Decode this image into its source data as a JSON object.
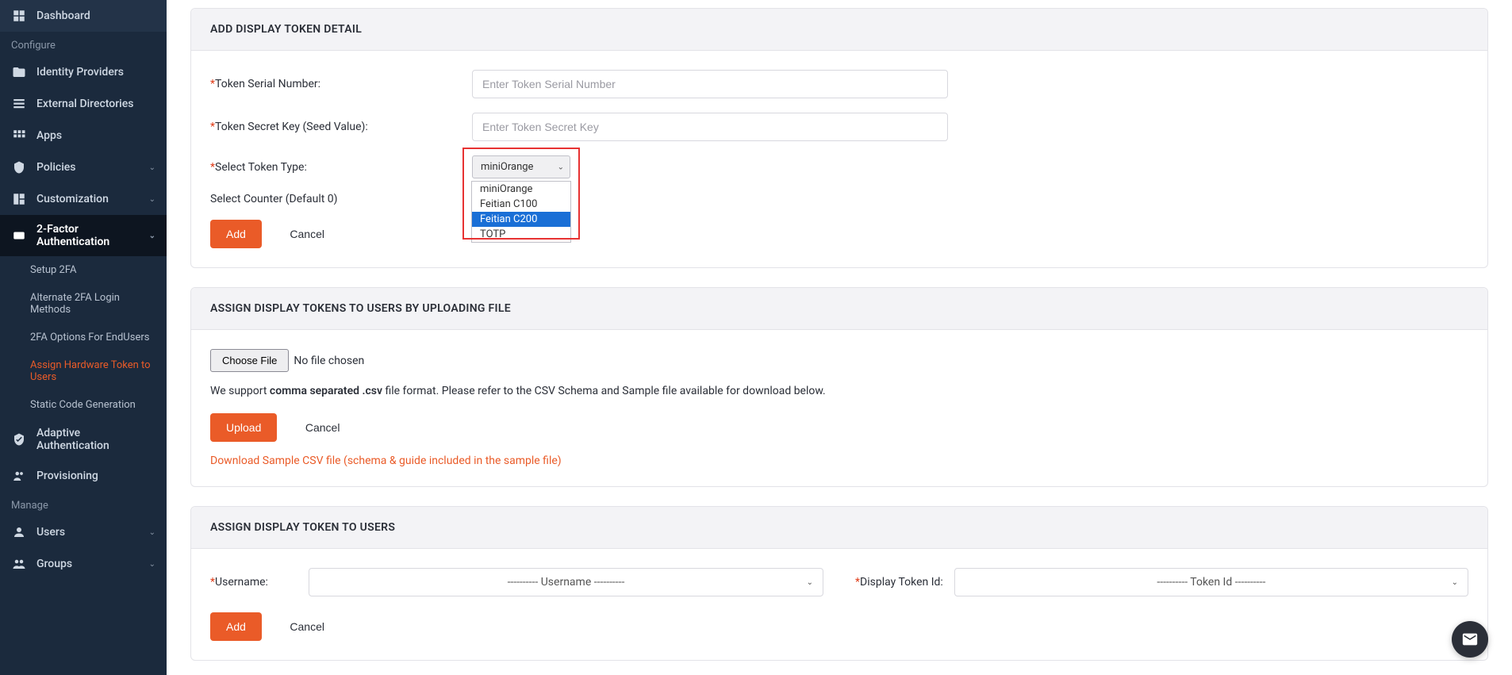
{
  "sidebar": {
    "items": [
      {
        "label": "Dashboard",
        "icon": "dashboard"
      }
    ],
    "section_configure": "Configure",
    "configure_items": [
      {
        "label": "Identity Providers",
        "icon": "idp"
      },
      {
        "label": "External Directories",
        "icon": "directories"
      },
      {
        "label": "Apps",
        "icon": "apps"
      },
      {
        "label": "Policies",
        "icon": "policies",
        "chev": true
      },
      {
        "label": "Customization",
        "icon": "custom",
        "chev": true
      },
      {
        "label": "2-Factor Authentication",
        "icon": "2fa",
        "chev": true,
        "active": true
      },
      {
        "label": "Adaptive Authentication",
        "icon": "adaptive"
      },
      {
        "label": "Provisioning",
        "icon": "provisioning"
      }
    ],
    "sub_2fa": [
      {
        "label": "Setup 2FA"
      },
      {
        "label": "Alternate 2FA Login Methods"
      },
      {
        "label": "2FA Options For EndUsers"
      },
      {
        "label": "Assign Hardware Token to Users",
        "highlight": true
      },
      {
        "label": "Static Code Generation"
      }
    ],
    "section_manage": "Manage",
    "manage_items": [
      {
        "label": "Users",
        "icon": "users",
        "chev": true
      },
      {
        "label": "Groups",
        "icon": "groups",
        "chev": true
      }
    ]
  },
  "panel1": {
    "title": "ADD DISPLAY TOKEN DETAIL",
    "serial_label": "Token Serial Number:",
    "serial_placeholder": "Enter Token Serial Number",
    "secret_label": "Token Secret Key (Seed Value):",
    "secret_placeholder": "Enter Token Secret Key",
    "type_label": "Select Token Type:",
    "type_selected": "miniOrange",
    "type_options": [
      "miniOrange",
      "Feitian C100",
      "Feitian C200",
      "TOTP"
    ],
    "type_highlighted_index": 2,
    "counter_label": "Select Counter (Default 0)",
    "add_btn": "Add",
    "cancel_btn": "Cancel"
  },
  "panel2": {
    "title": "ASSIGN DISPLAY TOKENS TO USERS BY UPLOADING FILE",
    "choose_file": "Choose File",
    "no_file": "No file chosen",
    "support_prefix": "We support ",
    "support_bold": "comma separated .csv",
    "support_suffix": " file format. Please refer to the CSV Schema and Sample file available for download below.",
    "upload_btn": "Upload",
    "cancel_btn": "Cancel",
    "download_link": "Download Sample CSV file (schema & guide included in the sample file)"
  },
  "panel3": {
    "title": "ASSIGN DISPLAY TOKEN TO USERS",
    "username_label": "Username:",
    "username_placeholder": "---------- Username ----------",
    "tokenid_label": "Display Token Id:",
    "tokenid_placeholder": "---------- Token Id ----------",
    "add_btn": "Add",
    "cancel_btn": "Cancel"
  }
}
